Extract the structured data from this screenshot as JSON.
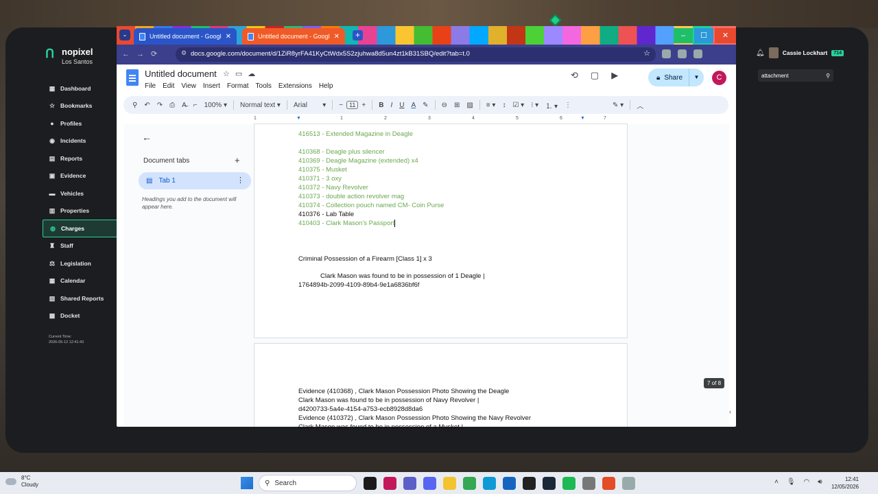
{
  "mdt": {
    "brand": "nopixel",
    "city": "Los Santos",
    "nav": [
      {
        "label": "Dashboard",
        "icon": "dashboard-icon",
        "glyph": "▦"
      },
      {
        "label": "Bookmarks",
        "icon": "star-icon",
        "glyph": "☆"
      },
      {
        "label": "Profiles",
        "icon": "user-icon",
        "glyph": "●"
      },
      {
        "label": "Incidents",
        "icon": "incident-icon",
        "glyph": "◉"
      },
      {
        "label": "Reports",
        "icon": "report-icon",
        "glyph": "▤"
      },
      {
        "label": "Evidence",
        "icon": "evidence-icon",
        "glyph": "▣"
      },
      {
        "label": "Vehicles",
        "icon": "car-icon",
        "glyph": "▬"
      },
      {
        "label": "Properties",
        "icon": "building-icon",
        "glyph": "▥"
      },
      {
        "label": "Charges",
        "icon": "location-pin-icon",
        "glyph": "◍"
      },
      {
        "label": "Staff",
        "icon": "staff-icon",
        "glyph": "♜"
      },
      {
        "label": "Legislation",
        "icon": "gavel-icon",
        "glyph": "⚖"
      },
      {
        "label": "Calendar",
        "icon": "calendar-icon",
        "glyph": "▦"
      },
      {
        "label": "Shared Reports",
        "icon": "shared-reports-icon",
        "glyph": "▧"
      },
      {
        "label": "Docket",
        "icon": "docket-icon",
        "glyph": "▩"
      }
    ],
    "active_nav": "Charges",
    "current_time_label": "Current Time:",
    "current_time_value": "2026-05-12 12:41:43",
    "user_name": "Cassie Lockhart",
    "user_badge": "714",
    "search_value": "attachment"
  },
  "browser": {
    "tabs": [
      {
        "title": "Untitled document - Google D..."
      },
      {
        "title": "Untitled document - Google D..."
      }
    ],
    "url": "docs.google.com/document/d/1ZiR8yrFA41KyCtWdx5S2zjuhwa8d5un4zt1kB31SBQ/edit?tab=t.0"
  },
  "docs": {
    "title": "Untitled document",
    "menu": [
      "File",
      "Edit",
      "View",
      "Insert",
      "Format",
      "Tools",
      "Extensions",
      "Help"
    ],
    "share_label": "Share",
    "avatar_initial": "C",
    "toolbar": {
      "zoom": "100%",
      "style": "Normal text",
      "font": "Arial",
      "font_size": "11"
    },
    "ruler_numbers": [
      "1",
      "1",
      "2",
      "3",
      "4",
      "5",
      "6",
      "7"
    ],
    "tabs_panel": {
      "title": "Document tabs",
      "tab_label": "Tab 1",
      "hint": "Headings you add to the document will appear here."
    },
    "page1_lines": [
      {
        "text": "416513 - Extended Magazine in Deagle",
        "color": "green"
      },
      {
        "text": "410368 - Deagle plus silencer",
        "color": "green"
      },
      {
        "text": "410369 - Deagle Magazine (extended) x4",
        "color": "green"
      },
      {
        "text": "410375 - Musket",
        "color": "green"
      },
      {
        "text": "410371 - 3 oxy",
        "color": "green"
      },
      {
        "text": "410372 - Navy Revolver",
        "color": "green"
      },
      {
        "text": "410373 - double action revolver mag",
        "color": "green"
      },
      {
        "text": "410374 - Collection pouch named CM- Coin Purse",
        "color": "green"
      },
      {
        "text": "410376 - Lab Table",
        "color": "black"
      },
      {
        "text": "410403 - Clark Mason's Passport",
        "color": "green"
      },
      {
        "text": "Criminal Possession of a Firearm [Class 1] x 3",
        "color": "black"
      },
      {
        "text": "Clark Mason was found to be in possession of 1 Deagle |",
        "color": "black"
      },
      {
        "text": "1764894b-2099-4109-89b4-9e1a6836bf6f",
        "color": "black"
      }
    ],
    "page2_lines": [
      {
        "text": "Evidence (410368) , Clark Mason Possession Photo Showing the Deagle",
        "color": "black"
      },
      {
        "text": "Clark Mason was found to be in possession of Navy Revolver |",
        "color": "black"
      },
      {
        "text": "d4200733-5a4e-4154-a753-ecb8928d8da6",
        "color": "black"
      },
      {
        "text": "Evidence (410372) , Clark Mason Possession Photo Showing the Navy Revolver",
        "color": "black"
      },
      {
        "text": "Clark Mason was found to be in possession of a Musket |",
        "color": "black"
      }
    ],
    "page_counter": "7 of 8"
  },
  "taskbar": {
    "temperature": "8°C",
    "weather": "Cloudy",
    "search_label": "Search",
    "time": "12:41",
    "date": "12/05/2026"
  }
}
